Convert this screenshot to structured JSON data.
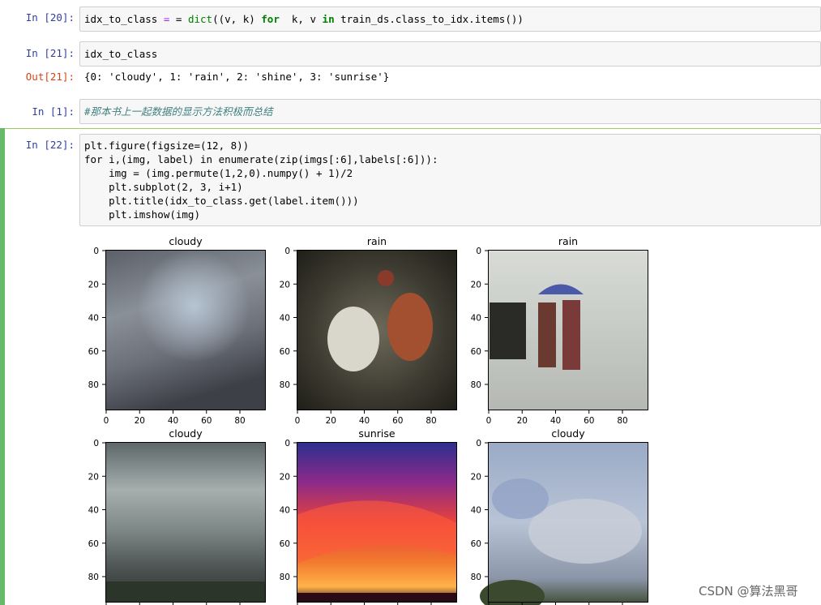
{
  "cells": [
    {
      "prompt": "In  [20]:",
      "code": [
        "idx_to_class = dict((v, k) for  k, v in train_ds.class_to_idx.items())"
      ]
    },
    {
      "prompt": "In  [21]:",
      "code": [
        "idx_to_class"
      ],
      "out_prompt": "Out[21]:",
      "output": "{0: 'cloudy', 1: 'rain', 2: 'shine', 3: 'sunrise'}"
    },
    {
      "prompt": "In  [1]:",
      "comment": "#那本书上一起数据的显示方法积极而总结"
    },
    {
      "prompt": "In  [22]:",
      "code": [
        "plt.figure(figsize=(12, 8))",
        "for i,(img, label) in enumerate(zip(imgs[:6],labels[:6])):",
        "    img = (img.permute(1,2,0).numpy() + 1)/2",
        "    plt.subplot(2, 3, i+1)",
        "    plt.title(idx_to_class.get(label.item()))",
        "    plt.imshow(img)"
      ]
    }
  ],
  "figure": {
    "subplots": [
      {
        "title": "cloudy",
        "image": "dark-grey-storm-clouds"
      },
      {
        "title": "rain",
        "image": "oxen-race-in-rain"
      },
      {
        "title": "rain",
        "image": "people-with-umbrella-in-rain"
      },
      {
        "title": "cloudy",
        "image": "overcast-sky-over-field"
      },
      {
        "title": "sunrise",
        "image": "red-orange-sunrise-sky"
      },
      {
        "title": "cloudy",
        "image": "blue-sky-with-grey-clouds"
      }
    ],
    "xticks": [
      "0",
      "20",
      "40",
      "60",
      "80"
    ],
    "yticks": [
      "0",
      "20",
      "40",
      "60",
      "80"
    ]
  },
  "watermark": "CSDN @算法黑哥"
}
